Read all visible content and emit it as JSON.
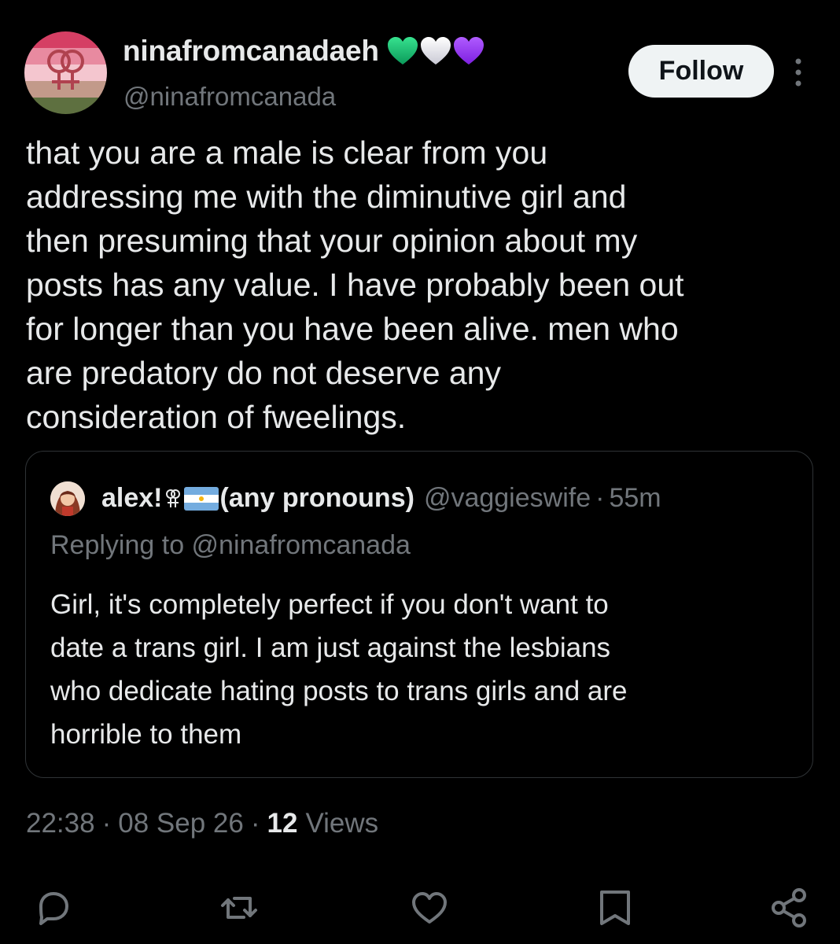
{
  "post": {
    "author": {
      "display_name": "ninafromcanadaeh",
      "emoji_hearts": [
        "green-heart",
        "white-heart",
        "purple-heart"
      ],
      "handle": "@ninafromcanada",
      "avatar_icon": "lesbian-flag-double-venus-avatar"
    },
    "follow_label": "Follow",
    "more_icon": "more-vertical-icon",
    "text": "that you are a male is clear from you\naddressing me with the diminutive girl and\nthen presuming that your opinion about my\nposts has any value. I have probably been out\nfor longer than you have been alive.  men who\nare predatory do not deserve any\nconsideration of fweelings.",
    "quoted": {
      "name_prefix": "alex!",
      "name_suffix": "(any pronouns)",
      "icons": [
        "double-venus-icon",
        "argentina-flag-icon"
      ],
      "handle": "@vaggieswife",
      "separator": "·",
      "time": "55m",
      "replying_to": "Replying to @ninafromcanada",
      "text": "Girl, it's completely perfect if you don't want to\ndate a trans girl. I am just against the lesbians\nwho dedicate hating posts to trans girls and are\nhorrible to them"
    },
    "meta": {
      "time": "22:38",
      "separator": "·",
      "date": "08 Sep 26",
      "views_count": "12",
      "views_label": "Views"
    },
    "actions": [
      "reply-icon",
      "repost-icon",
      "like-icon",
      "bookmark-icon",
      "share-icon"
    ],
    "colors": {
      "background": "#000000",
      "text": "#e7e9ea",
      "secondary": "#71767b",
      "border": "#2f3336",
      "follow_bg": "#eff3f4"
    }
  }
}
